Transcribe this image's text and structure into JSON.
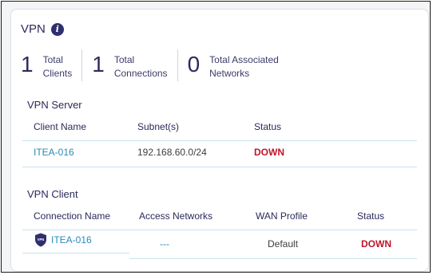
{
  "card": {
    "title": "VPN",
    "info_icon": "info-icon"
  },
  "stats": [
    {
      "value": "1",
      "label_line1": "Total",
      "label_line2": "Clients"
    },
    {
      "value": "1",
      "label_line1": "Total",
      "label_line2": "Connections"
    },
    {
      "value": "0",
      "label_line1": "Total Associated",
      "label_line2": "Networks"
    }
  ],
  "vpn_server": {
    "title": "VPN Server",
    "headers": {
      "client_name": "Client Name",
      "subnets": "Subnet(s)",
      "status": "Status"
    },
    "rows": [
      {
        "client_name": "ITEA-016",
        "subnet": "192.168.60.0/24",
        "status": "DOWN"
      }
    ]
  },
  "vpn_client": {
    "title": "VPN Client",
    "headers": {
      "connection_name": "Connection Name",
      "access_networks": "Access Networks",
      "wan_profile": "WAN Profile",
      "status": "Status"
    },
    "rows": [
      {
        "connection_name": "ITEA-016",
        "access_networks": "---",
        "wan_profile": "Default",
        "status": "DOWN",
        "icon": "vpn-shield-icon"
      }
    ]
  },
  "colors": {
    "title": "#2b2a5c",
    "link": "#2a8ab8",
    "status_down": "#c0152a",
    "row_divider": "#c9e3ee"
  }
}
